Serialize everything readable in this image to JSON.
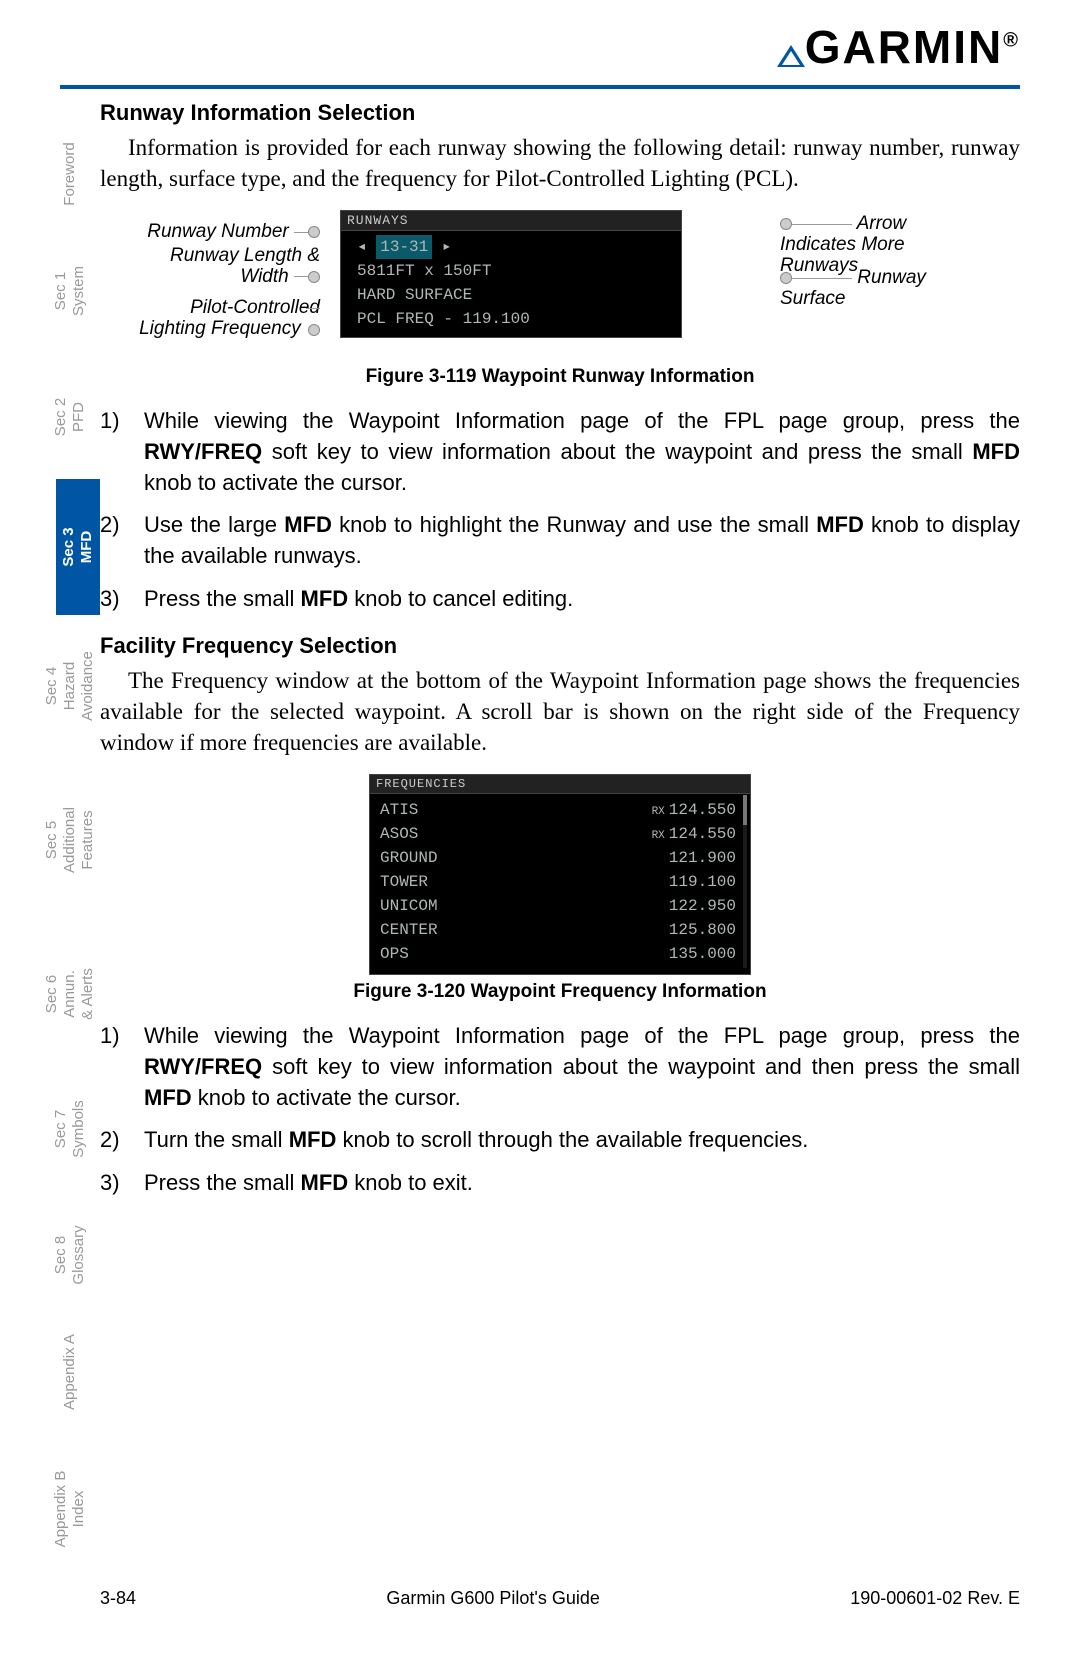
{
  "header": {
    "brand": "GARMIN"
  },
  "sidebar": {
    "tabs": [
      {
        "label": "Foreword"
      },
      {
        "label": "Sec 1\nSystem"
      },
      {
        "label": "Sec 2\nPFD"
      },
      {
        "label": "Sec 3\nMFD",
        "active": true
      },
      {
        "label": "Sec 4\nHazard\nAvoidance"
      },
      {
        "label": "Sec 5\nAdditional\nFeatures"
      },
      {
        "label": "Sec 6\nAnnun.\n& Alerts"
      },
      {
        "label": "Sec 7\nSymbols"
      },
      {
        "label": "Sec 8\nGlossary"
      },
      {
        "label": "Appendix A"
      },
      {
        "label": "Appendix B\nIndex"
      }
    ]
  },
  "section1": {
    "heading": "Runway Information Selection",
    "paragraph": "Information is provided for each runway showing the following detail: runway number, runway length, surface type, and the frequency for Pilot-Controlled Lighting (PCL).",
    "callouts": {
      "runway_number": "Runway Number",
      "runway_length": "Runway Length & Width",
      "pcl": "Pilot-Controlled Lighting Frequency",
      "arrow": "Arrow Indicates More Runways",
      "surface": "Runway Surface"
    },
    "runway_box": {
      "title": "RUNWAYS",
      "line1_prefix": "◂ ",
      "line1_id": "13-31",
      "line1_suffix": " ▸",
      "line2": "5811FT  x  150FT",
      "line3": "HARD SURFACE",
      "line4": "PCL FREQ -  119.100"
    },
    "caption": "Figure 3-119  Waypoint Runway Information",
    "steps": [
      {
        "n": "1)",
        "t": "While viewing the Waypoint Information page of the FPL page group, press the <b>RWY/FREQ</b> soft key to view information about the waypoint and press the small <b>MFD</b> knob to activate the cursor."
      },
      {
        "n": "2)",
        "t": "Use the large <b>MFD</b> knob to highlight the Runway and use the small <b>MFD</b> knob to display the available runways."
      },
      {
        "n": "3)",
        "t": "Press the small <b>MFD</b> knob to cancel editing."
      }
    ]
  },
  "section2": {
    "heading": "Facility Frequency Selection",
    "paragraph": "The Frequency window at the bottom of the Waypoint Information page shows the frequencies available for the selected waypoint. A scroll bar is shown on the right side of the Frequency window if more frequencies are available.",
    "freq_box": {
      "title": "FREQUENCIES",
      "rows": [
        {
          "name": "ATIS",
          "rx": "RX",
          "freq": "124.550"
        },
        {
          "name": "ASOS",
          "rx": "RX",
          "freq": "124.550"
        },
        {
          "name": "GROUND",
          "rx": "",
          "freq": "121.900"
        },
        {
          "name": "TOWER",
          "rx": "",
          "freq": "119.100"
        },
        {
          "name": "UNICOM",
          "rx": "",
          "freq": "122.950"
        },
        {
          "name": "CENTER",
          "rx": "",
          "freq": "125.800"
        },
        {
          "name": "OPS",
          "rx": "",
          "freq": "135.000"
        }
      ]
    },
    "caption": "Figure 3-120  Waypoint Frequency Information",
    "steps": [
      {
        "n": "1)",
        "t": "While viewing the Waypoint Information page of the FPL page group, press the <b>RWY/FREQ</b> soft key to view information about the waypoint and then press the small <b>MFD</b> knob to activate the cursor."
      },
      {
        "n": "2)",
        "t": "Turn the small <b>MFD</b> knob to scroll through the available frequencies."
      },
      {
        "n": "3)",
        "t": "Press the small <b>MFD</b> knob to exit."
      }
    ]
  },
  "footer": {
    "page": "3-84",
    "title": "Garmin G600 Pilot's Guide",
    "rev": "190-00601-02  Rev. E"
  }
}
